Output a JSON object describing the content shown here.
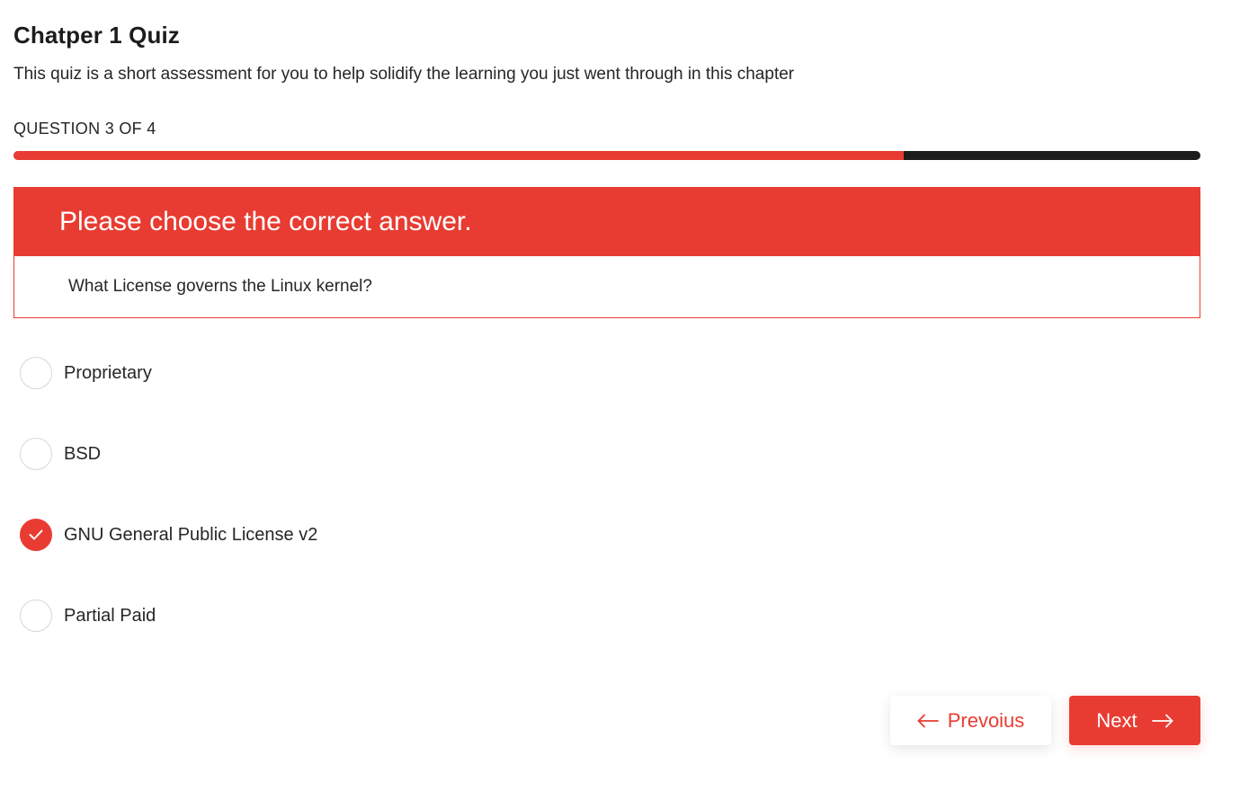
{
  "quiz": {
    "title": "Chatper 1 Quiz",
    "description": "This quiz is a short assessment for you to help solidify the learning you just went through in this chapter"
  },
  "progress": {
    "label": "QUESTION 3 OF 4",
    "fraction": 0.75
  },
  "question": {
    "prompt": "Please choose the correct answer.",
    "text": "What License governs the Linux kernel?"
  },
  "options": [
    {
      "label": "Proprietary",
      "selected": false
    },
    {
      "label": "BSD",
      "selected": false
    },
    {
      "label": "GNU General Public License v2",
      "selected": true
    },
    {
      "label": "Partial Paid",
      "selected": false
    }
  ],
  "navigation": {
    "previous_label": "Prevoius",
    "previous_icon": "arrow-left-icon",
    "next_label": "Next",
    "next_icon": "arrow-right-icon"
  },
  "colors": {
    "accent": "#e83c32",
    "track": "#1c1c1c"
  }
}
